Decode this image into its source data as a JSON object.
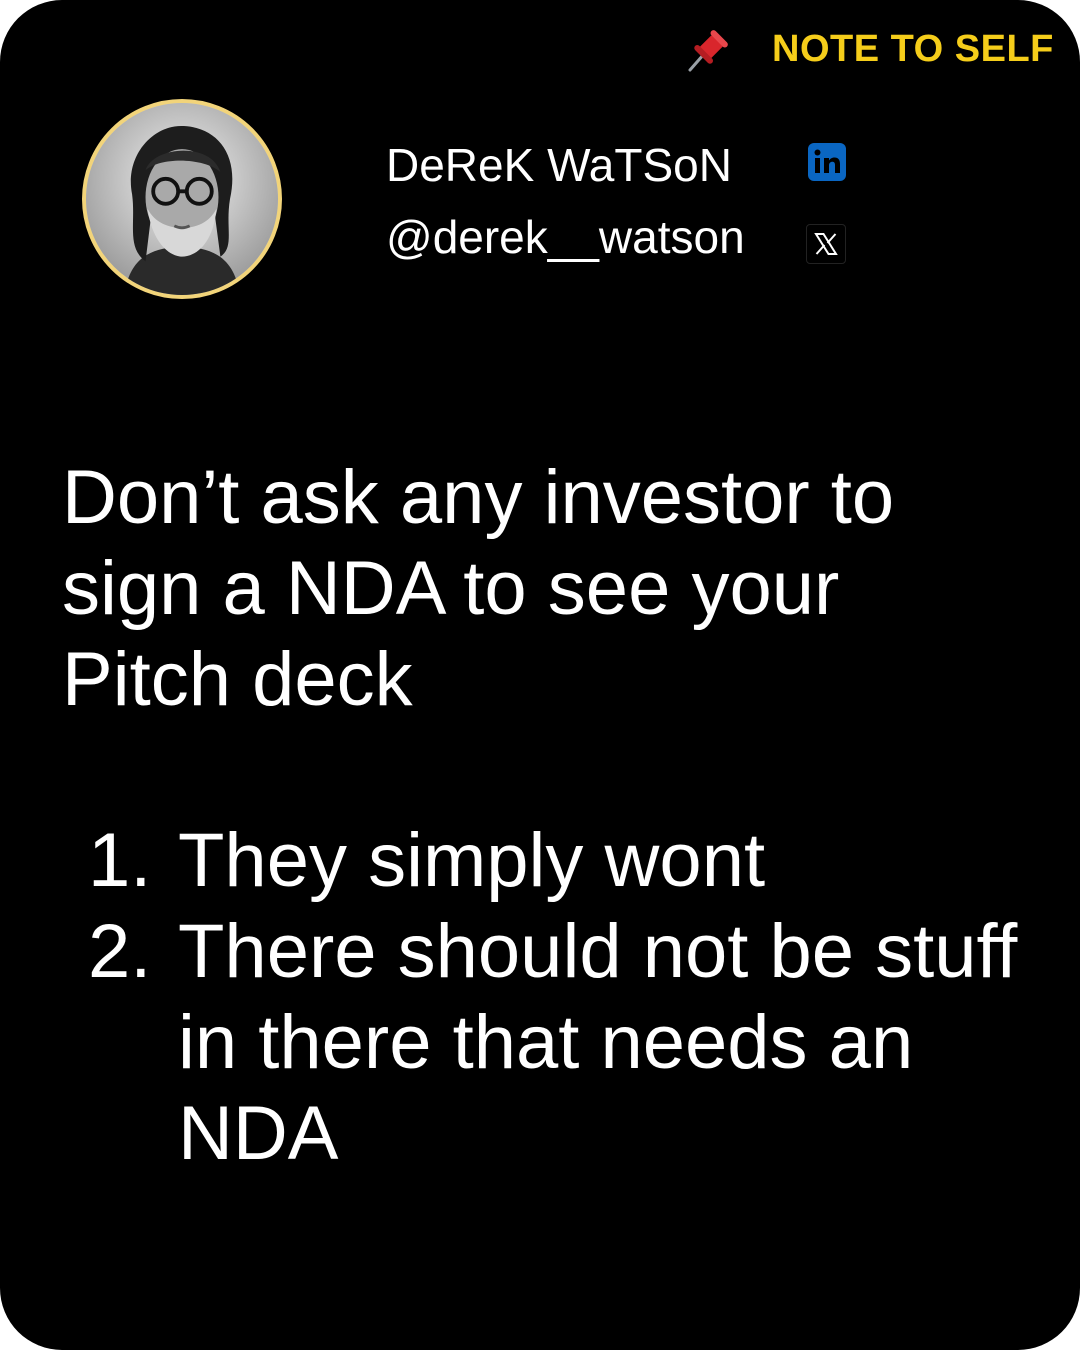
{
  "header": {
    "pin_icon": "pushpin-icon",
    "label": "NOTE TO SELF",
    "label_color": "#f5cd1a"
  },
  "profile": {
    "avatar_icon": "profile-photo",
    "name": "DeReK WaTSoN",
    "handle": "@derek__watson",
    "linkedin_icon": "linkedin-icon",
    "x_icon": "x-icon",
    "linkedin_color": "#0a66c2"
  },
  "post": {
    "headline": "Don’t ask any investor to sign a NDA to see your Pitch deck",
    "points": [
      {
        "number": "1.",
        "text": "They simply wont"
      },
      {
        "number": "2.",
        "text": "There should not be stuff in there that needs an NDA"
      }
    ]
  }
}
